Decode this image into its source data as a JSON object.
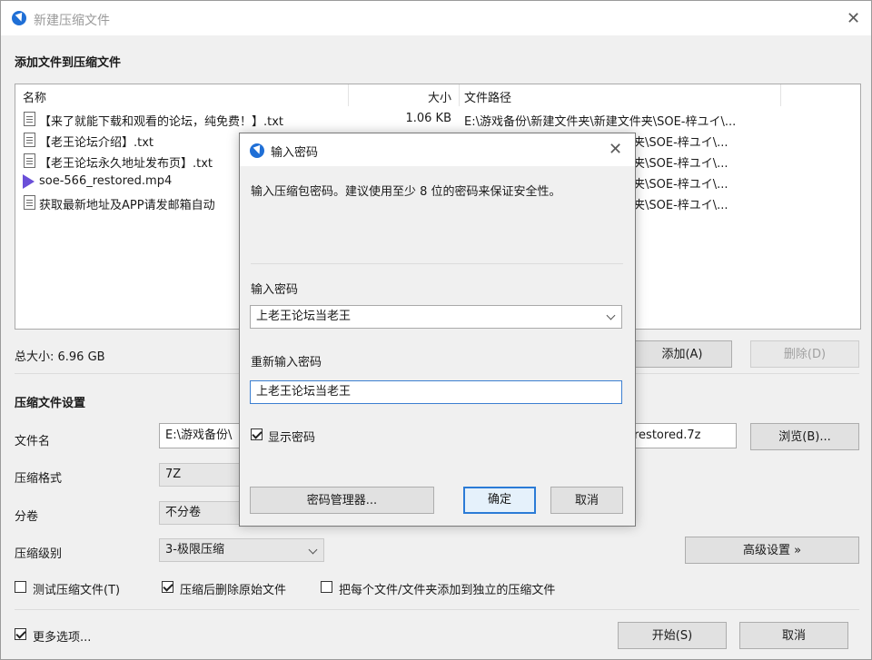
{
  "window": {
    "title": "新建压缩文件",
    "close": "✕"
  },
  "files_section": {
    "title": "添加文件到压缩文件",
    "columns": {
      "name": "名称",
      "size": "大小",
      "path": "文件路径"
    },
    "rows": [
      {
        "name": "【来了就能下载和观看的论坛，纯免费！】.txt",
        "size": "1.06 KB",
        "path": "E:\\游戏备份\\新建文件夹\\新建文件夹\\SOE-梓ユイ\\...",
        "icon": "text-file-icon"
      },
      {
        "name": "【老王论坛介绍】.txt",
        "size": "",
        "path": "夹\\SOE-梓ユイ\\...",
        "icon": "text-file-icon"
      },
      {
        "name": "【老王论坛永久地址发布页】.txt",
        "size": "",
        "path": "夹\\SOE-梓ユイ\\...",
        "icon": "text-file-icon"
      },
      {
        "name": "soe-566_restored.mp4",
        "size": "",
        "path": "夹\\SOE-梓ユイ\\...",
        "icon": "video-file-icon"
      },
      {
        "name": "获取最新地址及APP请发邮箱自动",
        "size": "",
        "path": "夹\\SOE-梓ユイ\\...",
        "icon": "text-file-icon"
      }
    ],
    "total_size": "总大小: 6.96 GB",
    "add_label": "添加(A)",
    "delete_label": "删除(D)"
  },
  "settings": {
    "title": "压缩文件设置",
    "filename_label": "文件名",
    "filename_value_left": "E:\\游戏备份\\",
    "filename_value_right": "restored.7z",
    "browse_label": "浏览(B)...",
    "format_label": "压缩格式",
    "format_value": "7Z",
    "split_label": "分卷",
    "split_value": "不分卷",
    "level_label": "压缩级别",
    "level_value": "3-极限压缩",
    "advanced_label": "高级设置 »",
    "test_label": "测试压缩文件(T)",
    "test_checked": false,
    "delete_after_label": "压缩后删除原始文件",
    "delete_after_checked": true,
    "each_separate_label": "把每个文件/文件夹添加到独立的压缩文件",
    "each_separate_checked": false
  },
  "footer": {
    "more_options_label": "更多选项...",
    "more_options_checked": true,
    "start_label": "开始(S)",
    "cancel_label": "取消"
  },
  "dialog": {
    "title": "输入密码",
    "close": "✕",
    "description": "输入压缩包密码。建议使用至少 8 位的密码来保证安全性。",
    "password_label": "输入密码",
    "password_value": "上老王论坛当老王",
    "repeat_label": "重新输入密码",
    "repeat_value": "上老王论坛当老王",
    "show_password_label": "显示密码",
    "show_password_checked": true,
    "manager_label": "密码管理器...",
    "ok_label": "确定",
    "cancel_label": "取消"
  },
  "colors": {
    "accent": "#1f6fd6",
    "primary_border": "#2b7bd6"
  }
}
